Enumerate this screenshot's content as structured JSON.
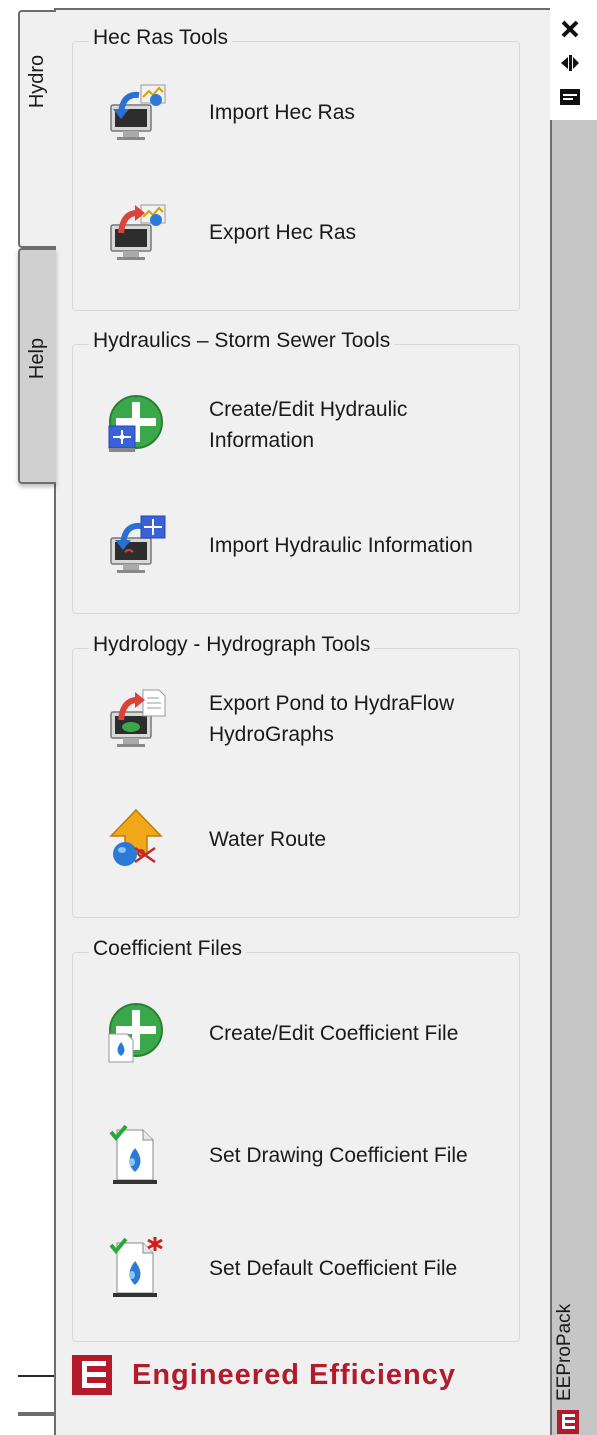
{
  "tabs": [
    {
      "label": "Hydro",
      "active": true
    },
    {
      "label": "Help",
      "active": false
    }
  ],
  "groups": [
    {
      "title": "Hec Ras Tools",
      "tools": [
        {
          "label": "Import Hec Ras",
          "icon": "import-hec-ras-icon"
        },
        {
          "label": "Export Hec Ras",
          "icon": "export-hec-ras-icon"
        }
      ]
    },
    {
      "title": "Hydraulics – Storm Sewer Tools",
      "tools": [
        {
          "label": "Create/Edit Hydraulic Information",
          "icon": "create-hydraulic-info-icon"
        },
        {
          "label": "Import Hydraulic Information",
          "icon": "import-hydraulic-info-icon"
        }
      ]
    },
    {
      "title": "Hydrology - Hydrograph Tools",
      "tools": [
        {
          "label": "Export Pond to HydraFlow HydroGraphs",
          "icon": "export-pond-icon"
        },
        {
          "label": "Water Route",
          "icon": "water-route-icon"
        }
      ]
    },
    {
      "title": "Coefficient Files",
      "tools": [
        {
          "label": "Create/Edit Coefficient File",
          "icon": "create-coefficient-file-icon"
        },
        {
          "label": "Set Drawing Coefficient File",
          "icon": "set-drawing-coefficient-icon"
        },
        {
          "label": "Set Default Coefficient File",
          "icon": "set-default-coefficient-icon"
        }
      ]
    }
  ],
  "logo": {
    "text": "Engineered Efficiency"
  },
  "palette": {
    "title": "EEProPack",
    "buttons": [
      "close-icon",
      "auto-hide-icon",
      "properties-icon"
    ]
  },
  "colors": {
    "brand_red": "#b31b2c",
    "panel_bg": "#f0f0f0",
    "strip_bg": "#c6c6c6"
  }
}
